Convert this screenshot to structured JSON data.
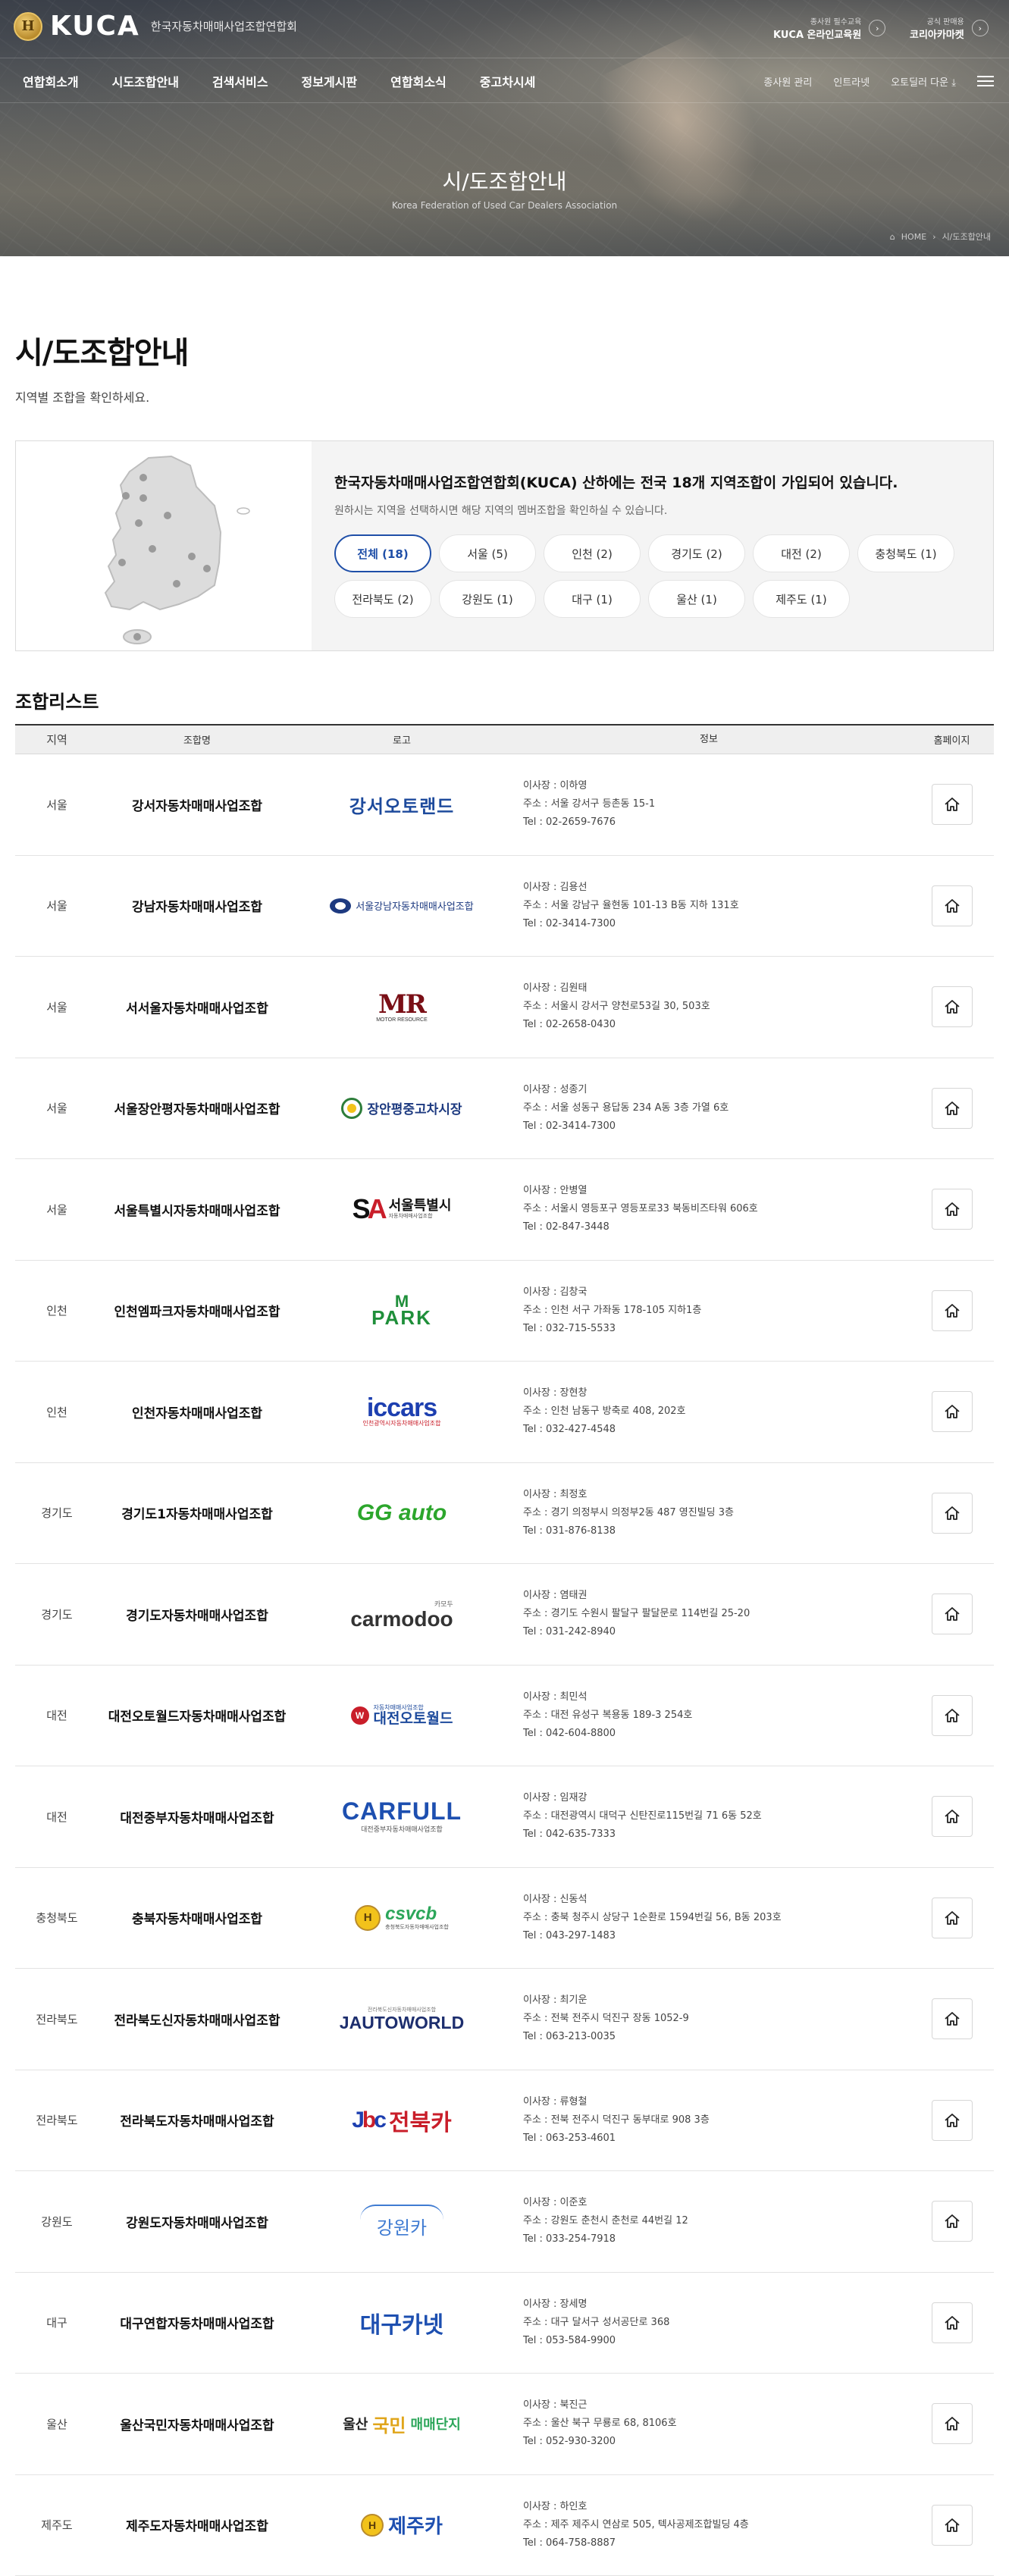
{
  "header": {
    "brand": "KUCA",
    "brand_sub": "한국자동차매매사업조합연합회",
    "promo1_small": "종사원 필수교육",
    "promo1_big": "KUCA 온라인교육원",
    "promo2_small": "공식 판매용",
    "promo2_big": "코리아카마켓",
    "nav": [
      "연합회소개",
      "시도조합안내",
      "검색서비스",
      "정보게시판",
      "연합회소식",
      "중고차시세"
    ],
    "util": [
      "종사원 관리",
      "인트라넷",
      "오토딜러 다운"
    ],
    "hero_title": "시/도조합안내",
    "hero_sub": "Korea Federation of Used Car Dealers Association",
    "crumb_home": "HOME",
    "crumb_page": "시/도조합안내"
  },
  "page": {
    "title": "시/도조합안내",
    "desc": "지역별 조합을 확인하세요."
  },
  "info": {
    "headline": "한국자동차매매사업조합연합회(KUCA) 산하에는 전국 18개 지역조합이 가입되어 있습니다.",
    "sub": "원하시는 지역을 선택하시면 해당 지역의 멤버조합을 확인하실 수 있습니다.",
    "chips": [
      "전체 (18)",
      "서울 (5)",
      "인천 (2)",
      "경기도 (2)",
      "대전 (2)",
      "충청북도 (1)",
      "전라북도 (2)",
      "강원도 (1)",
      "대구 (1)",
      "울산 (1)",
      "제주도 (1)"
    ]
  },
  "list": {
    "title": "조합리스트",
    "headers": {
      "region": "지역",
      "name": "조합명",
      "logo": "로고",
      "info": "정보",
      "home": "홈페이지"
    },
    "rows": [
      {
        "region": "서울",
        "name": "강서자동차매매사업조합",
        "logo": "강서오토랜드",
        "chair": "이사장 : 이하영",
        "addr": "주소 : 서울 강서구 등촌동 15-1",
        "tel": "Tel : 02-2659-7676"
      },
      {
        "region": "서울",
        "name": "강남자동차매매사업조합",
        "logo": "서울강남자동차매매사업조합",
        "chair": "이사장 : 김용선",
        "addr": "주소 : 서울 강남구 율현동 101-13 B동 지하 131호",
        "tel": "Tel : 02-3414-7300"
      },
      {
        "region": "서울",
        "name": "서서울자동차매매사업조합",
        "logo": "MR",
        "logo_sub": "MOTOR RESOURCE",
        "chair": "이사장 : 김원태",
        "addr": "주소 : 서울시 강서구 양천로53길 30, 503호",
        "tel": "Tel : 02-2658-0430"
      },
      {
        "region": "서울",
        "name": "서울장안평자동차매매사업조합",
        "logo": "장안평중고차시장",
        "chair": "이사장 : 성종기",
        "addr": "주소 : 서울 성동구 용답동 234 A동 3층 가열 6호",
        "tel": "Tel : 02-3414-7300"
      },
      {
        "region": "서울",
        "name": "서울특별시자동차매매사업조합",
        "logo": "서울특별시",
        "logo_sub": "자동차매매사업조합",
        "chair": "이사장 : 안병열",
        "addr": "주소 : 서울시 영등포구 영등포로33 북동비즈타워 606호",
        "tel": "Tel : 02-847-3448"
      },
      {
        "region": "인천",
        "name": "인천엠파크자동차매매사업조합",
        "logo": "PARK",
        "chair": "이사장 : 김창국",
        "addr": "주소 : 인천 서구 가좌동 178-105 지하1층",
        "tel": "Tel : 032-715-5533"
      },
      {
        "region": "인천",
        "name": "인천자동차매매사업조합",
        "logo": "iccars",
        "logo_sub": "인천광역시자동차매매사업조합",
        "chair": "이사장 : 장현창",
        "addr": "주소 : 인천 남동구 방축로 408, 202호",
        "tel": "Tel : 032-427-4548"
      },
      {
        "region": "경기도",
        "name": "경기도1자동차매매사업조합",
        "logo": "GG auto",
        "chair": "이사장 : 최정호",
        "addr": "주소 : 경기 의정부시 의정부2동 487 영진빌딩 3층",
        "tel": "Tel : 031-876-8138"
      },
      {
        "region": "경기도",
        "name": "경기도자동차매매사업조합",
        "logo": "carmodoo",
        "logo_sub": "카모두",
        "chair": "이사장 : 염태권",
        "addr": "주소 : 경기도 수원시 팔달구 팔달문로 114번길 25-20",
        "tel": "Tel : 031-242-8940"
      },
      {
        "region": "대전",
        "name": "대전오토월드자동차매매사업조합",
        "logo": "대전오토월드",
        "logo_sub": "자동차매매사업조합",
        "chair": "이사장 : 최민석",
        "addr": "주소 : 대전 유성구 복용동 189-3 254호",
        "tel": "Tel : 042-604-8800"
      },
      {
        "region": "대전",
        "name": "대전중부자동차매매사업조합",
        "logo": "CARFULL",
        "logo_sub": "대전중부자동차매매사업조합",
        "chair": "이사장 : 임재강",
        "addr": "주소 : 대전광역시 대덕구 신탄진로115번길 71 6동 52호",
        "tel": "Tel : 042-635-7333"
      },
      {
        "region": "충청북도",
        "name": "충북자동차매매사업조합",
        "logo": "csvcb",
        "logo_sub": "충청북도자동차매매사업조합",
        "chair": "이사장 : 신동석",
        "addr": "주소 : 충북 청주시 상당구 1순환로 1594번길 56, B동 203호",
        "tel": "Tel : 043-297-1483"
      },
      {
        "region": "전라북도",
        "name": "전라북도신자동차매매사업조합",
        "logo": "JAUTOWORLD",
        "logo_sub": "전라북도신자동차매매사업조합",
        "chair": "이사장 : 최기운",
        "addr": "주소 : 전북 전주시 덕진구 장동 1052-9",
        "tel": "Tel : 063-213-0035"
      },
      {
        "region": "전라북도",
        "name": "전라북도자동차매매사업조합",
        "logo": "전북카",
        "chair": "이사장 : 류형철",
        "addr": "주소 : 전북 전주시 덕진구 동부대로 908 3층",
        "tel": "Tel : 063-253-4601"
      },
      {
        "region": "강원도",
        "name": "강원도자동차매매사업조합",
        "logo": "강원카",
        "chair": "이사장 : 이준호",
        "addr": "주소 : 강원도 춘천시 춘천로 44번길 12",
        "tel": "Tel : 033-254-7918"
      },
      {
        "region": "대구",
        "name": "대구연합자동차매매사업조합",
        "logo": "대구카넷",
        "chair": "이사장 : 장세명",
        "addr": "주소 : 대구 달서구 성서공단로 368",
        "tel": "Tel : 053-584-9900"
      },
      {
        "region": "울산",
        "name": "울산국민자동차매매사업조합",
        "logo": "울산",
        "logo_mid": "국민",
        "logo_end": "매매단지",
        "chair": "이사장 : 북진근",
        "addr": "주소 : 울산 북구 무룡로 68, 8106호",
        "tel": "Tel : 052-930-3200"
      },
      {
        "region": "제주도",
        "name": "제주도자동차매매사업조합",
        "logo": "제주카",
        "chair": "이사장 : 하인호",
        "addr": "주소 : 제주 제주시 연삼로 505, 텍사공제조합빌딩 4층",
        "tel": "Tel : 064-758-8887"
      }
    ]
  }
}
